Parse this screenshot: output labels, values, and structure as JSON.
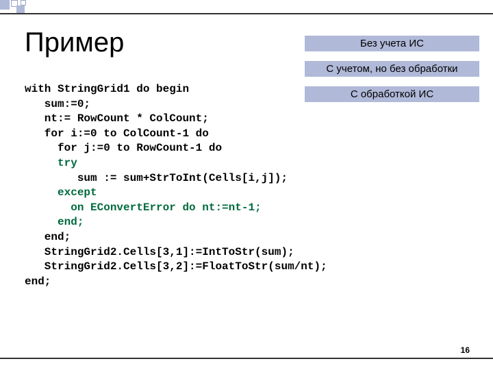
{
  "title": "Пример",
  "badges": [
    "Без учета ИС",
    "С учетом, но без обработки",
    "С обработкой ИС"
  ],
  "code": {
    "l1": "with StringGrid1 do begin",
    "l2": "   sum:=0;",
    "l3": "   nt:= RowCount * ColCount;",
    "l4": "   for i:=0 to ColCount-1 do",
    "l5": "     for j:=0 to RowCount-1 do",
    "l6a": "     ",
    "l6b": "try",
    "l7": "        sum := sum+StrToInt(Cells[i,j]);",
    "l8a": "     ",
    "l8b": "except",
    "l9a": "       ",
    "l9b": "on EConvertError do nt:=nt-1;",
    "l10a": "     ",
    "l10b": "end;",
    "l11": "   end;",
    "l12": "   StringGrid2.Cells[3,1]:=IntToStr(sum);",
    "l13": "   StringGrid2.Cells[3,2]:=FloatToStr(sum/nt);",
    "l14": "end;"
  },
  "page_number": "16"
}
